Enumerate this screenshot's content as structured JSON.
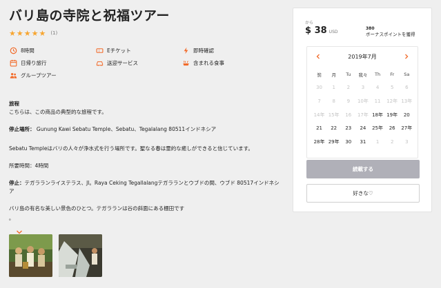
{
  "title": "バリ島の寺院と祝福ツアー",
  "rating": {
    "stars": "★★★★★",
    "count": "(1)"
  },
  "features": [
    {
      "icon": "clock-icon",
      "label": "8時間"
    },
    {
      "icon": "ticket-icon",
      "label": "Eチケット"
    },
    {
      "icon": "lightning-icon",
      "label": "即時確認"
    },
    {
      "icon": "calendar-icon",
      "label": "日帰り旅行"
    },
    {
      "icon": "car-icon",
      "label": "送迎サービス"
    },
    {
      "icon": "meal-icon",
      "label": "含まれる食事"
    },
    {
      "icon": "group-icon",
      "label": "グループツアー"
    }
  ],
  "itinerary": {
    "heading": "旅程",
    "intro": "こちらは、この商品の典型的な旅程です。",
    "stop1_label": "停止場所：",
    "stop1_text": " Gunung Kawi Sebatu Temple、Sebatu、Tegalalang 80511インドネシア",
    "stop1_desc": "Sebatu Templeはバリの人々が浄水式を行う場所です。聖なる春は霊的な癒しができると信じています。",
    "duration": "所要時間：4時間",
    "stop2_label": "停止：",
    "stop2_text": "テガラランライステラス、Jl。Raya Ceking Tegallalangテガラランとウブドの間、ウブド 80517インドネシア",
    "stop2_desc": "バリ島の有名な美しい景色のひとつ。テガラランは谷の斜面にある棚田です",
    "dot": "。"
  },
  "booking": {
    "from": "から",
    "price": "$ 38",
    "currency": "USD",
    "points_num": "380",
    "points_label": "ボーナスポイントを獲得",
    "book_label": "続載する",
    "fav_label": "好きな♡"
  },
  "calendar": {
    "month": "2019年7月",
    "weekdays": [
      "䈩",
      "月",
      "Tu",
      "我々",
      "Th",
      "Fr",
      "Sa"
    ],
    "weeks": [
      [
        {
          "t": "30",
          "d": true
        },
        {
          "t": "1",
          "d": true
        },
        {
          "t": "2",
          "d": true
        },
        {
          "t": "3",
          "d": true
        },
        {
          "t": "4",
          "d": true
        },
        {
          "t": "5",
          "d": true
        },
        {
          "t": "6",
          "d": true
        }
      ],
      [
        {
          "t": "7",
          "d": true
        },
        {
          "t": "8",
          "d": true
        },
        {
          "t": "9",
          "d": true
        },
        {
          "t": "10年",
          "d": true
        },
        {
          "t": "11",
          "d": true
        },
        {
          "t": "12年",
          "d": true
        },
        {
          "t": "13年",
          "d": true
        }
      ],
      [
        {
          "t": "14年",
          "d": true
        },
        {
          "t": "15年",
          "d": true
        },
        {
          "t": "16",
          "d": true
        },
        {
          "t": "17年",
          "d": true
        },
        {
          "t": "18年",
          "d": false
        },
        {
          "t": "19年",
          "d": false
        },
        {
          "t": "20",
          "d": false
        }
      ],
      [
        {
          "t": "21",
          "d": false
        },
        {
          "t": "22",
          "d": false
        },
        {
          "t": "23",
          "d": false
        },
        {
          "t": "24",
          "d": false
        },
        {
          "t": "25年",
          "d": false
        },
        {
          "t": "26",
          "d": false
        },
        {
          "t": "27年",
          "d": false
        }
      ],
      [
        {
          "t": "28年",
          "d": false
        },
        {
          "t": "29年",
          "d": false
        },
        {
          "t": "30",
          "d": false
        },
        {
          "t": "31",
          "d": false
        },
        {
          "t": "1",
          "d": true
        },
        {
          "t": "2",
          "d": true
        },
        {
          "t": "3",
          "d": true
        }
      ]
    ]
  },
  "colors": {
    "accent": "#f7a530",
    "icon": "#f26b2a",
    "book_button": "#b0b0b8"
  }
}
